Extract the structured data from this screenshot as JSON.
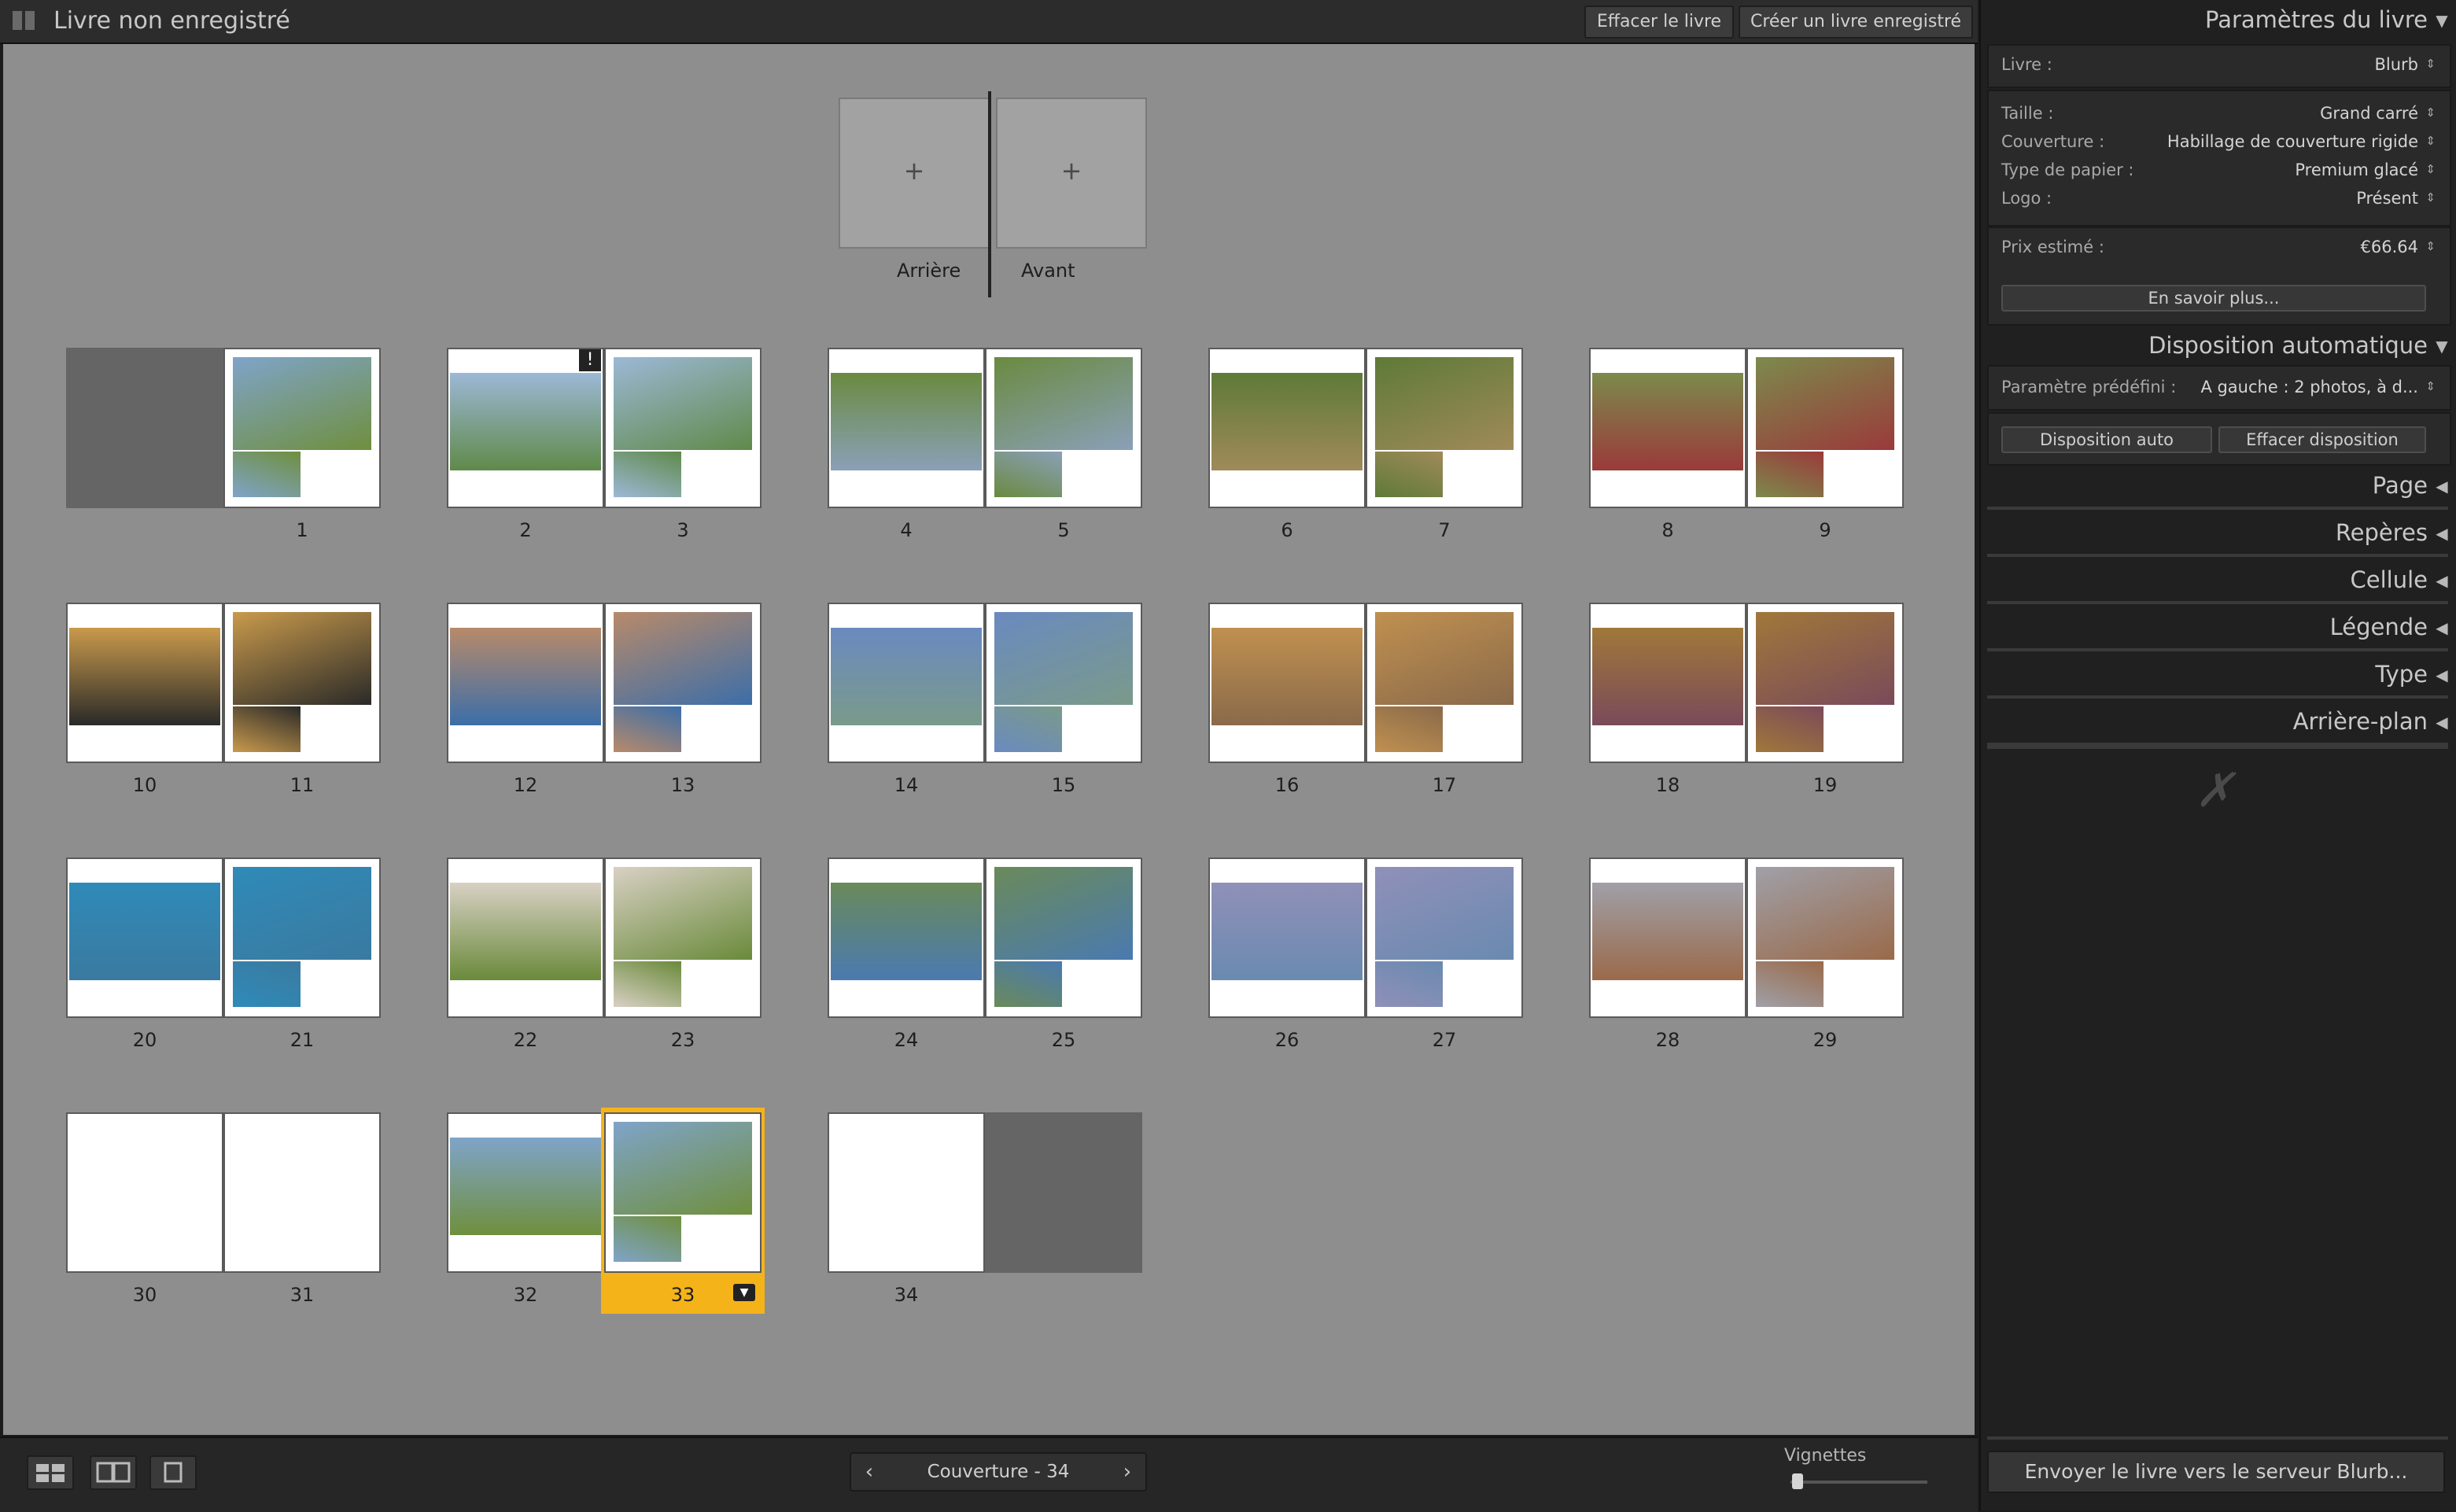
{
  "header": {
    "title": "Livre non enregistré",
    "clear_label": "Effacer le livre",
    "create_label": "Créer un livre enregistré"
  },
  "cover": {
    "back_label": "Arrière",
    "front_label": "Avant",
    "plus": "+"
  },
  "pages": [
    "1",
    "2",
    "3",
    "4",
    "5",
    "6",
    "7",
    "8",
    "9",
    "10",
    "11",
    "12",
    "13",
    "14",
    "15",
    "16",
    "17",
    "18",
    "19",
    "20",
    "21",
    "22",
    "23",
    "24",
    "25",
    "26",
    "27",
    "28",
    "29",
    "30",
    "31",
    "32",
    "33",
    "34"
  ],
  "selected_page": "33",
  "warning_page": "2",
  "footer": {
    "pager_label": "Couverture - 34",
    "prev_icon": "chevron-left-icon",
    "next_icon": "chevron-right-icon",
    "thumbs_label": "Vignettes",
    "views": [
      "multi-page-view",
      "spread-view",
      "single-page-view"
    ]
  },
  "panel": {
    "book_settings": {
      "title": "Paramètres du livre",
      "book_label": "Livre :",
      "book_value": "Blurb",
      "size_label": "Taille :",
      "size_value": "Grand carré",
      "cover_label": "Couverture :",
      "cover_value": "Habillage de couverture rigide",
      "paper_label": "Type de papier :",
      "paper_value": "Premium glacé",
      "logo_label": "Logo :",
      "logo_value": "Présent",
      "price_label": "Prix estimé :",
      "price_value": "€66.64",
      "learn_more": "En savoir plus..."
    },
    "auto_layout": {
      "title": "Disposition automatique",
      "preset_label": "Paramètre prédéfini :",
      "preset_value": "A gauche : 2 photos, à d...",
      "auto_btn": "Disposition auto",
      "clear_btn": "Effacer disposition"
    },
    "sections": [
      "Page",
      "Repères",
      "Cellule",
      "Légende",
      "Type",
      "Arrière-plan"
    ],
    "send_label": "Envoyer le livre vers le serveur Blurb..."
  },
  "colors": {
    "canvas": "#8e8e8e",
    "selection": "#f5b31a",
    "panel": "#202020",
    "bar": "#2c2c2c"
  }
}
